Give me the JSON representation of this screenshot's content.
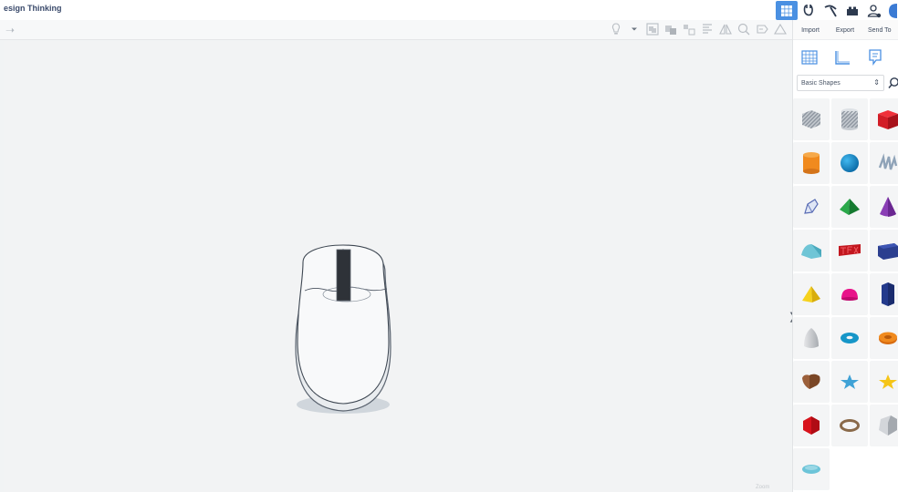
{
  "window": {
    "title": "esign Thinking"
  },
  "top_icons": [
    "grid-view-icon",
    "tinkercad-gears-icon",
    "pickaxe-icon",
    "brick-icon",
    "user-plus-icon",
    "profile-icon"
  ],
  "panel": {
    "actions": {
      "import": "Import",
      "export": "Export",
      "send_to": "Send To"
    },
    "views": [
      "workplane-icon",
      "ruler-icon",
      "notes-icon"
    ],
    "category": {
      "selected": "Basic Shapes"
    }
  },
  "shapes": [
    "box-striped",
    "cylinder-striped",
    "box",
    "cylinder",
    "sphere",
    "scribble",
    "shape-generators",
    "pyramid",
    "cone",
    "roof",
    "text",
    "wedge",
    "pyramid-yellow",
    "half-sphere",
    "polygon",
    "paraboloid",
    "torus",
    "tube",
    "heart",
    "star",
    "star-yellow",
    "icosahedron",
    "ring",
    "round-roof",
    "ellipsoid"
  ],
  "canvas": {
    "zoom_label": "Zoom"
  },
  "colors": {
    "accent": "#4a90e2",
    "panel_bg": "#ffffff",
    "canvas_bg": "#f2f3f4"
  }
}
